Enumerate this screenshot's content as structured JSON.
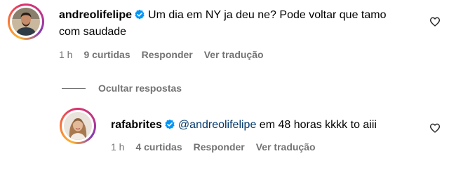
{
  "comments": [
    {
      "username": "andreolifelipe",
      "text": "Um dia em NY ja deu ne? Pode voltar que tamo com saudade",
      "time": "1 h",
      "likes": "9 curtidas",
      "reply_label": "Responder",
      "translate_label": "Ver tradução",
      "avatar_icon": "profile-photo-man",
      "like_icon": "heart-outline-icon"
    },
    {
      "username": "rafabrites",
      "mention": "@andreolifelipe",
      "text": " em 48 horas kkkk to aiii",
      "time": "1 h",
      "likes": "4 curtidas",
      "reply_label": "Responder",
      "translate_label": "Ver tradução",
      "avatar_icon": "profile-photo-woman",
      "like_icon": "heart-outline-icon"
    }
  ],
  "replies_toggle": {
    "label": "Ocultar respostas"
  },
  "colors": {
    "verified": "#0095f6",
    "meta_text": "#737373",
    "mention": "#00376b"
  }
}
